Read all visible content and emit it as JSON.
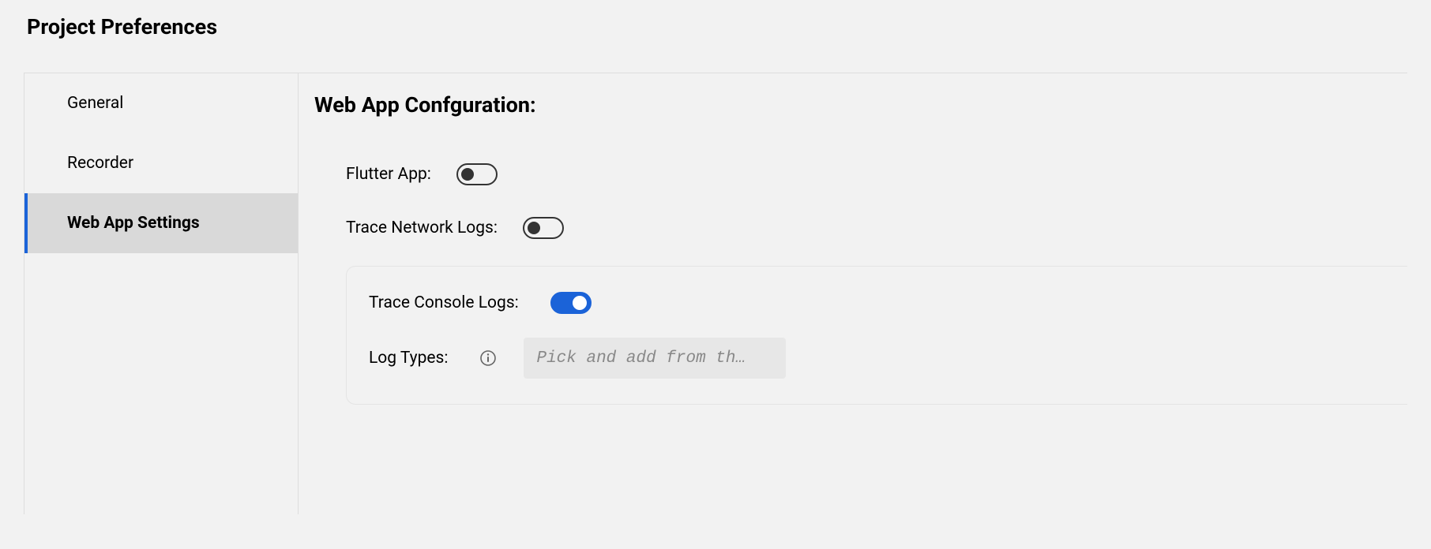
{
  "page_title": "Project Preferences",
  "sidebar": {
    "items": [
      {
        "label": "General",
        "active": false
      },
      {
        "label": "Recorder",
        "active": false
      },
      {
        "label": "Web App Settings",
        "active": true
      }
    ]
  },
  "content": {
    "title": "Web App Confguration:",
    "flutter_app": {
      "label": "Flutter App:",
      "state": "off"
    },
    "trace_network_logs": {
      "label": "Trace Network Logs:",
      "state": "off"
    },
    "trace_console_logs": {
      "label": "Trace Console Logs:",
      "state": "on"
    },
    "log_types": {
      "label": "Log Types:",
      "placeholder": "Pick and add from th…",
      "value": ""
    }
  }
}
